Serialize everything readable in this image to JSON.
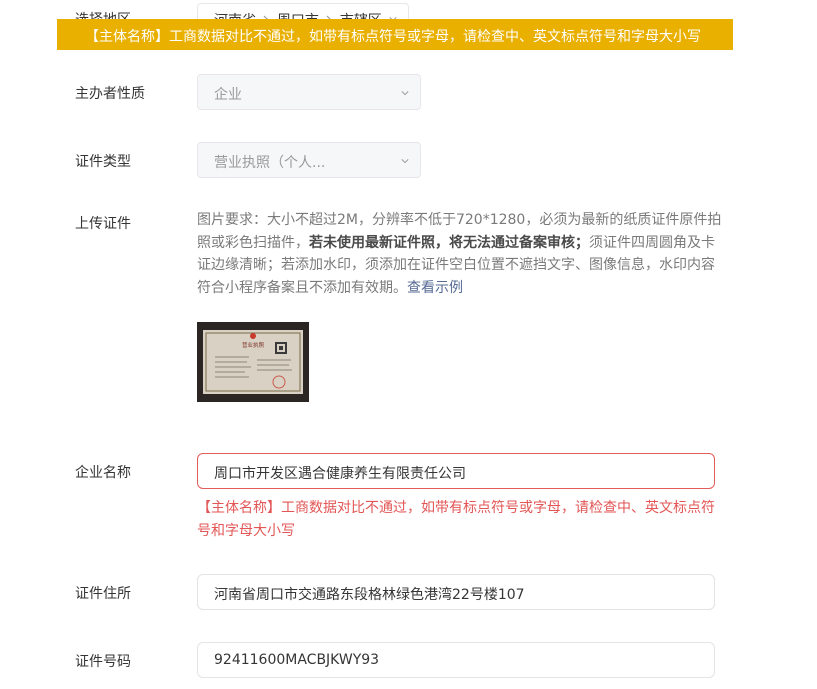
{
  "region": {
    "label": "选择地区",
    "province": "河南省",
    "city": "周口市",
    "district": "市辖区"
  },
  "banner": {
    "message": "【主体名称】工商数据对比不通过，如带有标点符号或字母，请检查中、英文标点符号和字母大小写"
  },
  "organizer_nature": {
    "label": "主办者性质",
    "value": "企业"
  },
  "cert_type": {
    "label": "证件类型",
    "value": "营业执照（个人..."
  },
  "upload": {
    "label": "上传证件",
    "hint_part1": "图片要求：大小不超过2M，分辨率不低于720*1280，必须为最新的纸质证件原件拍照或彩色扫描件，",
    "hint_bold": "若未使用最新证件照，将无法通过备案审核；",
    "hint_part2": "须证件四周圆角及卡证边缘清晰；若添加水印，须添加在证件空白位置不遮挡文字、图像信息，水印内容符合小程序备案且不添加有效期。",
    "example_link": "查看示例",
    "thumbnail_title": "营业执照"
  },
  "company_name": {
    "label": "企业名称",
    "value": "周口市开发区遇合健康养生有限责任公司",
    "error": "【主体名称】工商数据对比不通过，如带有标点符号或字母，请检查中、英文标点符号和字母大小写"
  },
  "cert_address": {
    "label": "证件住所",
    "value": "河南省周口市交通路东段格林绿色港湾22号楼107"
  },
  "cert_number": {
    "label": "证件号码",
    "value": "92411600MACBJKWY93"
  },
  "colors": {
    "banner_bg": "#e9b000",
    "error_red": "#e25656",
    "link_blue": "#576b95"
  },
  "icons": {
    "select_arrow": "chevron-down-icon",
    "region_separator": "chevron-right-icon"
  }
}
